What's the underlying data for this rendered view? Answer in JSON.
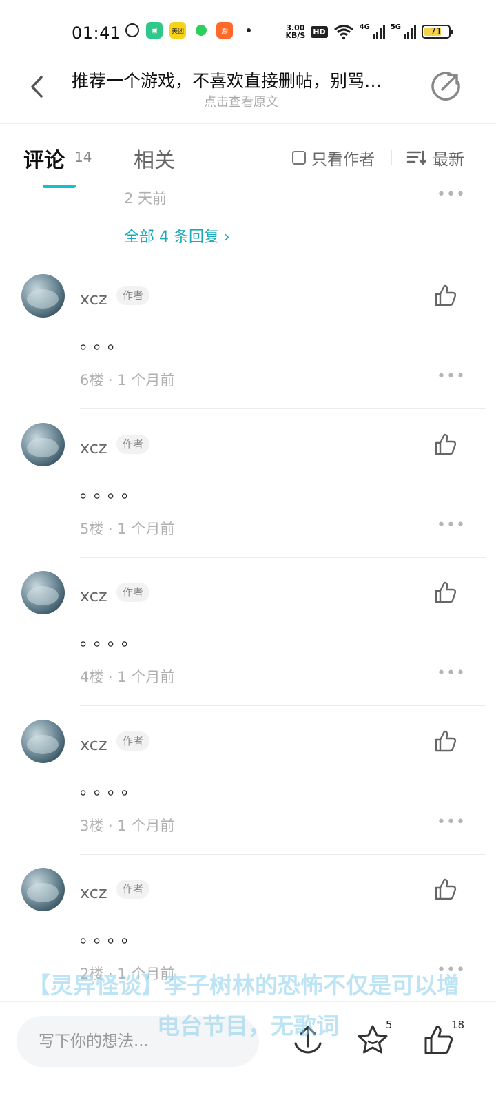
{
  "status_bar": {
    "time": "01:41",
    "speed_top": "3.00",
    "speed_unit": "KB/S",
    "hd_label": "HD",
    "net1": "4G",
    "net2": "5G",
    "battery": "71",
    "app_icons": [
      "netease-music-icon",
      "green-app-icon",
      "meituan-icon",
      "spotify-icon",
      "taobao-icon"
    ],
    "meituan_label": "美团"
  },
  "header": {
    "title": "推荐一个游戏，不喜欢直接删帖，别骂…",
    "subtitle": "点击查看原文"
  },
  "tabs": {
    "comments_label": "评论",
    "comments_count": "14",
    "related_label": "相关",
    "only_author_label": "只看作者",
    "sort_label": "最新",
    "accent_color": "#14c1c8"
  },
  "previous_comment": {
    "time": "2 天前",
    "replies_link": "全部 4 条回复 ›"
  },
  "comments": [
    {
      "user": "xcz",
      "badge": "作者",
      "body": "。。。",
      "meta": "6楼 · 1 个月前"
    },
    {
      "user": "xcz",
      "badge": "作者",
      "body": "。。。。",
      "meta": "5楼 · 1 个月前"
    },
    {
      "user": "xcz",
      "badge": "作者",
      "body": "。。。。",
      "meta": "4楼 · 1 个月前"
    },
    {
      "user": "xcz",
      "badge": "作者",
      "body": "。。。。",
      "meta": "3楼 · 1 个月前"
    },
    {
      "user": "xcz",
      "badge": "作者",
      "body": "。。。。",
      "meta": "2楼 · 1 个月前"
    }
  ],
  "overlay": {
    "line1": "【灵异怪谈】李子树林的恐怖不仅是可以增",
    "line2": "电台节目，无歌词"
  },
  "bottom_bar": {
    "input_placeholder": "写下你的想法...",
    "favorite_count": "5",
    "like_count": "18"
  }
}
